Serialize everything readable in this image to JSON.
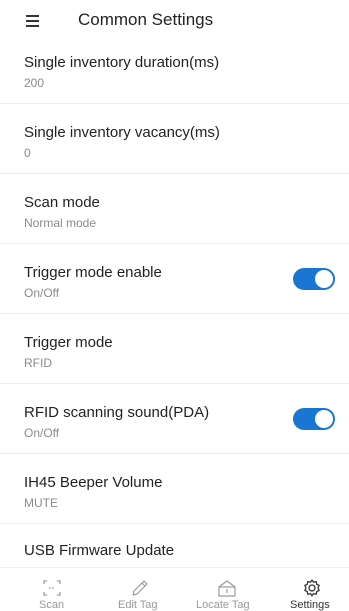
{
  "header": {
    "title": "Common Settings",
    "menu_icon": "hamburger-menu-icon"
  },
  "settings": {
    "single_inventory_duration": {
      "label": "Single inventory duration(ms)",
      "value": "200"
    },
    "single_inventory_vacancy": {
      "label": "Single inventory vacancy(ms)",
      "value": "0"
    },
    "scan_mode": {
      "label": "Scan mode",
      "value": "Normal mode"
    },
    "trigger_mode_enable": {
      "label": "Trigger mode enable",
      "value": "On/Off",
      "toggle_on": true
    },
    "trigger_mode": {
      "label": "Trigger mode",
      "value": "RFID"
    },
    "rfid_scanning_sound": {
      "label": "RFID scanning sound(PDA)",
      "value": "On/Off",
      "toggle_on": true
    },
    "beeper_volume": {
      "label": "IH45 Beeper Volume",
      "value": "MUTE"
    },
    "usb_firmware_update": {
      "label": "USB Firmware Update"
    }
  },
  "bottom_nav": {
    "items": [
      {
        "label": "Scan",
        "icon": "scan-icon",
        "active": false
      },
      {
        "label": "Edit Tag",
        "icon": "pencil-icon",
        "active": false
      },
      {
        "label": "Locate Tag",
        "icon": "locate-tag-icon",
        "active": false
      },
      {
        "label": "Settings",
        "icon": "gear-icon",
        "active": true
      }
    ]
  },
  "colors": {
    "toggle_on": "#1976d2",
    "divider": "#ebebeb",
    "secondary_text": "#8a8a8a",
    "nav_inactive": "#9a9a9a",
    "nav_active": "#333333"
  }
}
